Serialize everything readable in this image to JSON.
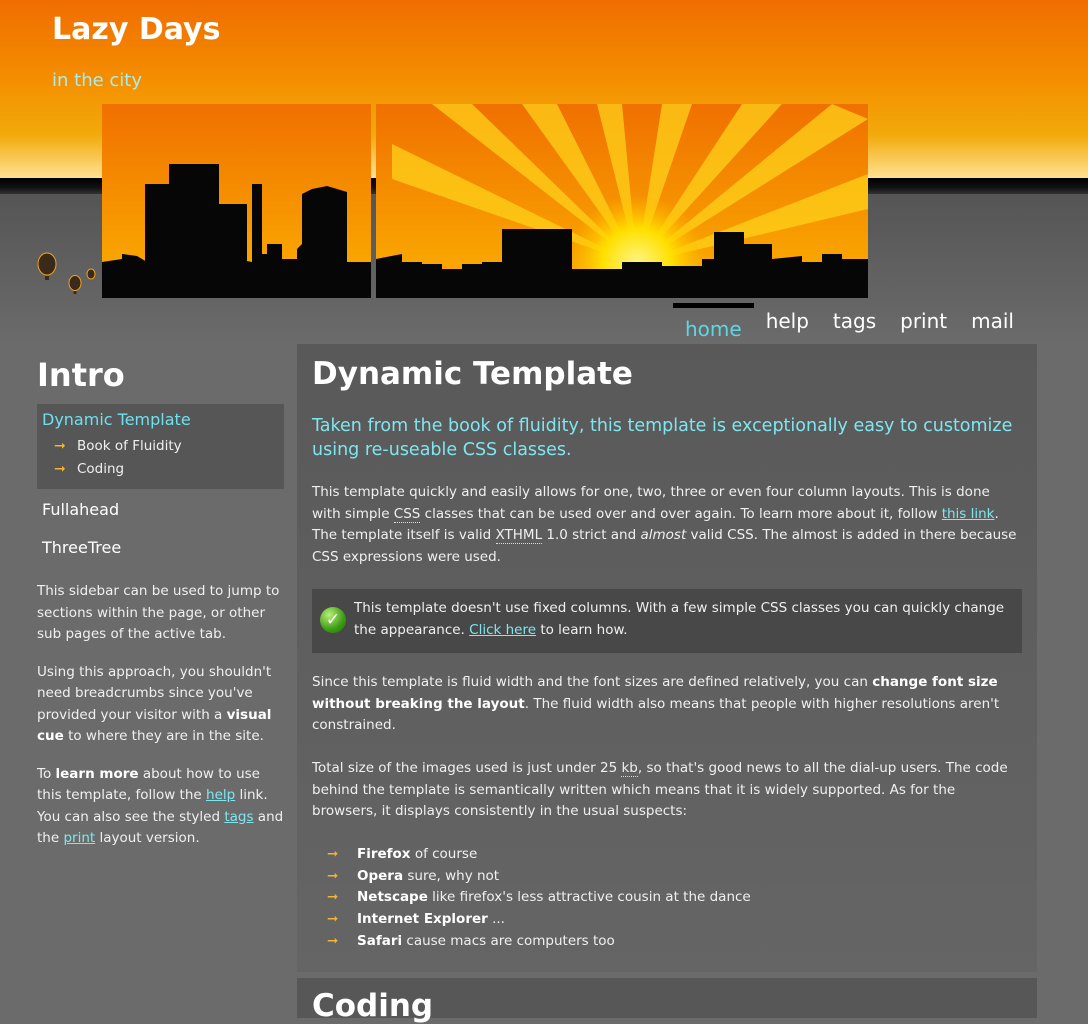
{
  "site": {
    "title": "Lazy Days",
    "subtitle": "in the city"
  },
  "nav": [
    {
      "label": "home",
      "active": true
    },
    {
      "label": "help"
    },
    {
      "label": "tags"
    },
    {
      "label": "print"
    },
    {
      "label": "mail"
    }
  ],
  "sidebar": {
    "heading": "Intro",
    "active_item": "Dynamic Template",
    "sub_items": [
      "Book of Fluidity",
      "Coding"
    ],
    "items": [
      "Fullahead",
      "ThreeTree"
    ],
    "p1": "This sidebar can be used to jump to sections within the page, or other sub pages of the active tab.",
    "p2_a": "Using this approach, you shouldn't need breadcrumbs since you've provided your visitor with a ",
    "p2_b": "visual cue",
    "p2_c": " to where they are in the site.",
    "p3_a": "To ",
    "p3_b": "learn more",
    "p3_c": " about how to use this template, follow the ",
    "p3_link1": "help",
    "p3_d": " link. You can also see the styled ",
    "p3_link2": "tags",
    "p3_e": " and the ",
    "p3_link3": "print",
    "p3_f": " layout version."
  },
  "main": {
    "title": "Dynamic Template",
    "lead": "Taken from the book of fluidity, this template is exceptionally easy to customize using re-useable CSS classes.",
    "p1_a": "This template quickly and easily allows for one, two, three or even four column layouts. This is done with simple ",
    "p1_css": "CSS",
    "p1_b": " classes that can be used over and over again. To learn more about it, follow ",
    "p1_link": "this link",
    "p1_c": ". The template itself is valid ",
    "p1_xhtml": "XTHML",
    "p1_d": " 1.0 strict and ",
    "p1_almost": "almost",
    "p1_e": " valid CSS. The almost is added in there because CSS expressions were used.",
    "note_a": "This template doesn't use fixed columns. With a few simple CSS classes you can quickly change the appearance. ",
    "note_link": "Click here",
    "note_b": " to learn how.",
    "p2_a": "Since this template is fluid width and the font sizes are defined relatively, you can ",
    "p2_b": "change font size without breaking the layout",
    "p2_c": ". The fluid width also means that people with higher resolutions aren't constrained.",
    "p3_a": "Total size of the images used is just under 25 ",
    "p3_kb": "kb",
    "p3_b": ", so that's good news to all the dial-up users. The code behind the template is semantically written which means that it is widely supported. As for the browsers, it displays consistently in the usual suspects:",
    "browsers": [
      {
        "name": "Firefox",
        "desc": " of course"
      },
      {
        "name": "Opera",
        "desc": " sure, why not"
      },
      {
        "name": "Netscape",
        "desc": " like firefox's less attractive cousin at the dance"
      },
      {
        "name": "Internet Explorer",
        "desc": " ..."
      },
      {
        "name": "Safari",
        "desc": " cause macs are computers too"
      }
    ],
    "next_title": "Coding"
  },
  "colors": {
    "accent": "#7fe6f0",
    "header_top": "#f06d00",
    "bullet": "#f5b331",
    "background": "#6b6b6b"
  },
  "icons": {
    "bullet": "arrow-right-icon",
    "note": "checkmark-icon"
  }
}
